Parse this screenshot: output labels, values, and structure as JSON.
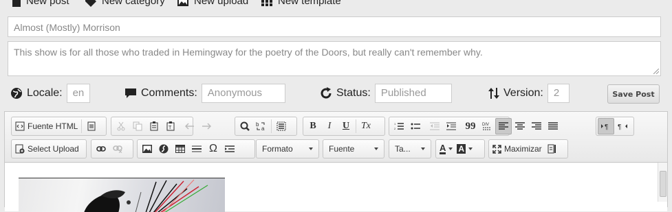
{
  "topnav": {
    "new_post": "New post",
    "new_category": "New category",
    "new_upload": "New upload",
    "new_template": "New template"
  },
  "post": {
    "title_value": "Almost (Mostly) Morrison",
    "description_value": "This show is for all those who traded in Hemingway for the poetry of the Doors, but really can't remember why."
  },
  "meta": {
    "locale_label": "Locale:",
    "locale_value": "en",
    "comments_label": "Comments:",
    "comments_value": "Anonymous",
    "status_label": "Status:",
    "status_value": "Published",
    "version_label": "Version:",
    "version_value": "2",
    "save_label": "Save Post"
  },
  "toolbar": {
    "source_label": "Fuente HTML",
    "select_upload_label": "Select Upload",
    "format_label": "Formato",
    "font_label": "Fuente",
    "size_label": "Ta...",
    "maximize_label": "Maximizar",
    "bold": "B",
    "italic": "I",
    "underline": "U",
    "remove_format": "Tx",
    "blockquote": "99",
    "special_char": "Ω",
    "text_color": "A",
    "bg_color": "A"
  },
  "colors": {
    "accent_dark": "#222222",
    "field_border": "#cccccc",
    "toolbar_bg": "#ececec"
  }
}
